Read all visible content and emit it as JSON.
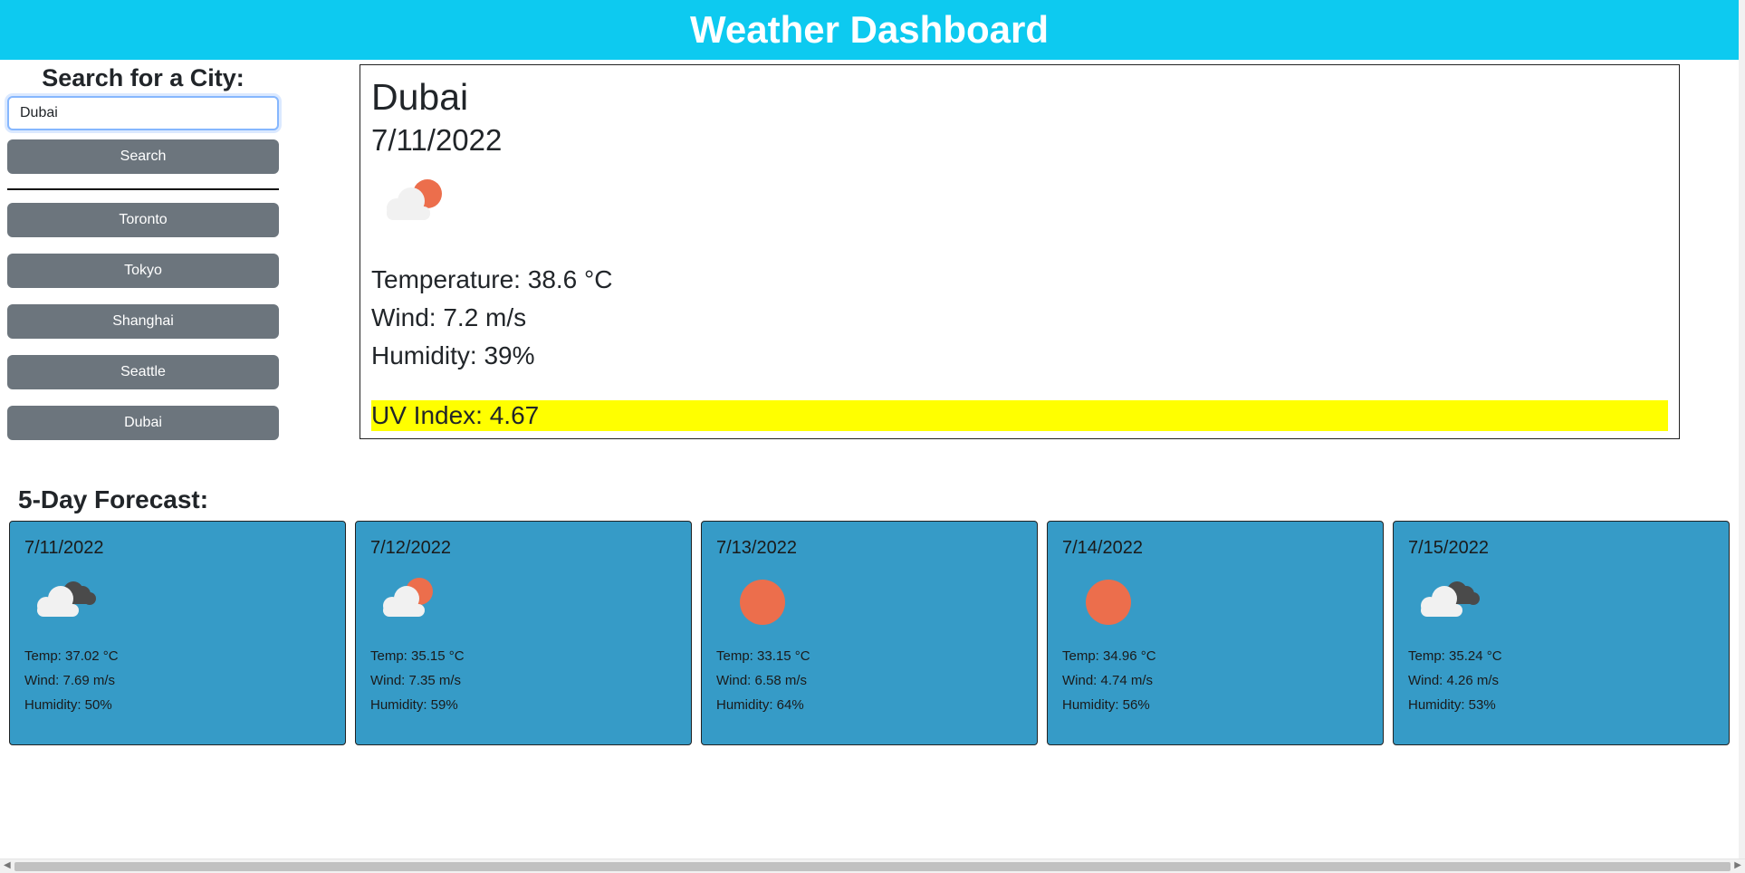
{
  "header": {
    "title": "Weather Dashboard"
  },
  "search": {
    "title": "Search for a City:",
    "input_value": "Dubai",
    "button_label": "Search"
  },
  "history": [
    "Toronto",
    "Tokyo",
    "Shanghai",
    "Seattle",
    "Dubai"
  ],
  "current": {
    "city": "Dubai",
    "date": "7/11/2022",
    "icon": "partly-cloudy-sun-icon",
    "temperature": "Temperature: 38.6 °C",
    "wind": "Wind: 7.2 m/s",
    "humidity": "Humidity: 39%",
    "uv": "UV Index: 4.67"
  },
  "forecast": {
    "title": "5-Day Forecast:",
    "days": [
      {
        "date": "7/11/2022",
        "icon": "dark-clouds-icon",
        "temp": "Temp: 37.02 °C",
        "wind": "Wind: 7.69 m/s",
        "humidity": "Humidity: 50%"
      },
      {
        "date": "7/12/2022",
        "icon": "partly-cloudy-sun-icon",
        "temp": "Temp: 35.15 °C",
        "wind": "Wind: 7.35 m/s",
        "humidity": "Humidity: 59%"
      },
      {
        "date": "7/13/2022",
        "icon": "sun-icon",
        "temp": "Temp: 33.15 °C",
        "wind": "Wind: 6.58 m/s",
        "humidity": "Humidity: 64%"
      },
      {
        "date": "7/14/2022",
        "icon": "sun-icon",
        "temp": "Temp: 34.96 °C",
        "wind": "Wind: 4.74 m/s",
        "humidity": "Humidity: 56%"
      },
      {
        "date": "7/15/2022",
        "icon": "dark-clouds-icon",
        "temp": "Temp: 35.24 °C",
        "wind": "Wind: 4.26 m/s",
        "humidity": "Humidity: 53%"
      }
    ]
  },
  "colors": {
    "header": "#0dcaf0",
    "button": "#6c757d",
    "card": "#369bc7",
    "uv_highlight": "#ffff00",
    "sun": "#ec6e4c"
  }
}
